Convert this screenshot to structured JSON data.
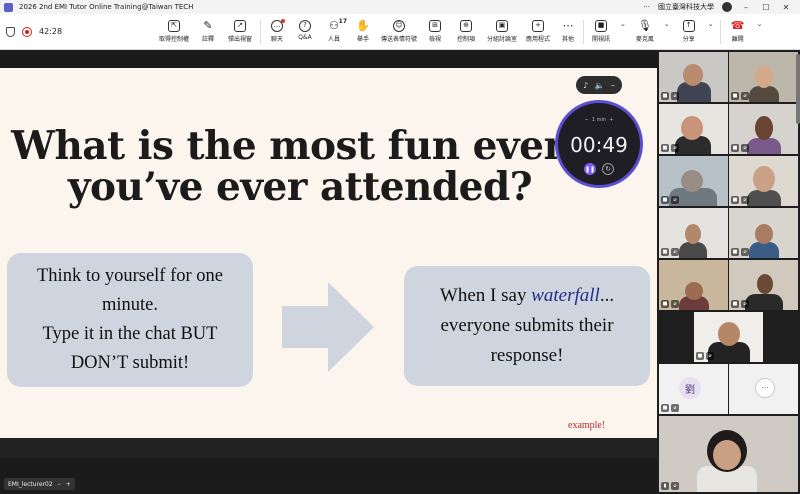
{
  "window": {
    "title": "2026 2nd EMI Tutor Online Training@Taiwan TECH",
    "org_name": "國立臺灣科技大學",
    "more_label": "···"
  },
  "toolbar": {
    "elapsed": "42:28",
    "tools": [
      {
        "label": "取得控制權",
        "icon": "remote-control-icon"
      },
      {
        "label": "註釋",
        "icon": "pen-icon"
      },
      {
        "label": "彈出視窗",
        "icon": "popout-icon"
      },
      {
        "label": "聊天",
        "icon": "chat-icon"
      },
      {
        "label": "Q&A",
        "icon": "qa-icon"
      },
      {
        "label": "人員",
        "icon": "people-icon",
        "count": "17"
      },
      {
        "label": "舉手",
        "icon": "hand-icon"
      },
      {
        "label": "傳送表情符號",
        "icon": "emoji-icon"
      },
      {
        "label": "檢視",
        "icon": "view-icon"
      },
      {
        "label": "控制項",
        "icon": "controls-icon"
      },
      {
        "label": "分組討論室",
        "icon": "breakout-icon"
      },
      {
        "label": "應用程式",
        "icon": "apps-icon"
      },
      {
        "label": "其他",
        "icon": "more-icon"
      }
    ],
    "media": [
      {
        "label": "開視訊",
        "icon": "video-icon"
      },
      {
        "label": "麥克風",
        "icon": "mic-off-icon"
      },
      {
        "label": "分享",
        "icon": "share-icon"
      },
      {
        "label": "離開",
        "icon": "hangup-icon"
      }
    ]
  },
  "slide": {
    "title_line1": "What is the most fun event",
    "title_line2": "you’ve ever attended?",
    "left_box_line1": "Think to yourself for one",
    "left_box_line2": "minute.",
    "left_box_line3": "Type it in the chat BUT",
    "left_box_line4": "DON’T submit!",
    "right_box_prefix": "When I say ",
    "right_box_keyword": "waterfall",
    "right_box_suffix": "...",
    "right_box_line2": "everyone submits their",
    "right_box_line3": "response!",
    "footnote": "example!"
  },
  "timer": {
    "preset": "1 min",
    "time": "00:49"
  },
  "self_view": {
    "name": "EMI_lecturer02"
  },
  "gallery": {
    "initial_tile_text": "劉",
    "more_tile_text": "···"
  },
  "colors": {
    "slide_bg": "#fbf5ee",
    "box_bg": "#cfd5de",
    "keyword": "#262a8a",
    "footnote": "#b1312c",
    "timer_ring": "#5a4ed1"
  }
}
